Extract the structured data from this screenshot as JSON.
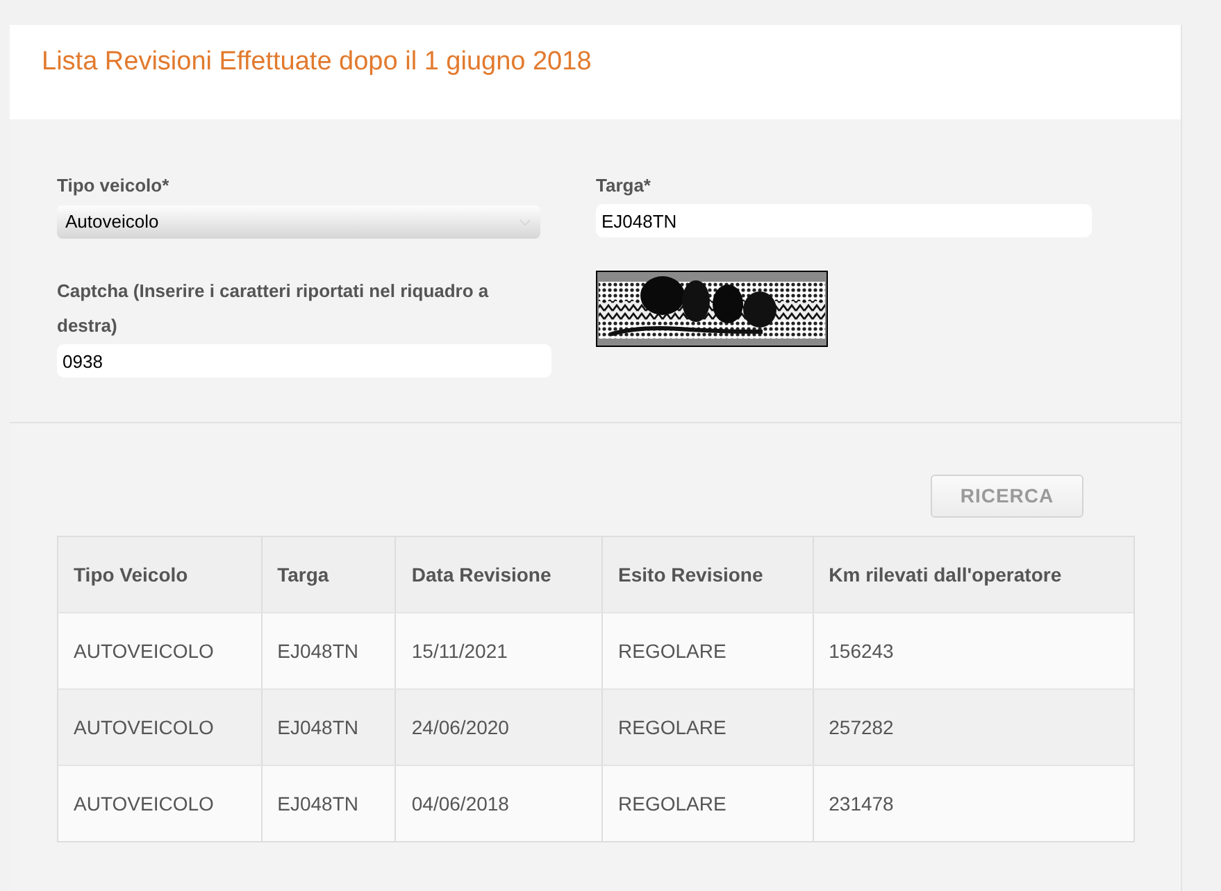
{
  "header": {
    "title": "Lista Revisioni Effettuate dopo il 1 giugno 2018"
  },
  "form": {
    "fields": [
      {
        "kind": "select",
        "label": "Tipo veicolo*",
        "value": "Autoveicolo"
      },
      {
        "kind": "text",
        "label": "Targa*",
        "value": "EJ048TN"
      },
      {
        "kind": "text",
        "label": "Captcha (Inserire i caratteri riportati nel riquadro a destra)",
        "value": "0938"
      }
    ]
  },
  "search_button": {
    "label": "RICERCA"
  },
  "table": {
    "columns": [
      "Tipo Veicolo",
      "Targa",
      "Data Revisione",
      "Esito Revisione",
      "Km rilevati dall'operatore"
    ],
    "rows": [
      [
        "AUTOVEICOLO",
        "EJ048TN",
        "15/11/2021",
        "REGOLARE",
        "156243"
      ],
      [
        "AUTOVEICOLO",
        "EJ048TN",
        "24/06/2020",
        "REGOLARE",
        "257282"
      ],
      [
        "AUTOVEICOLO",
        "EJ048TN",
        "04/06/2018",
        "REGOLARE",
        "231478"
      ]
    ]
  }
}
